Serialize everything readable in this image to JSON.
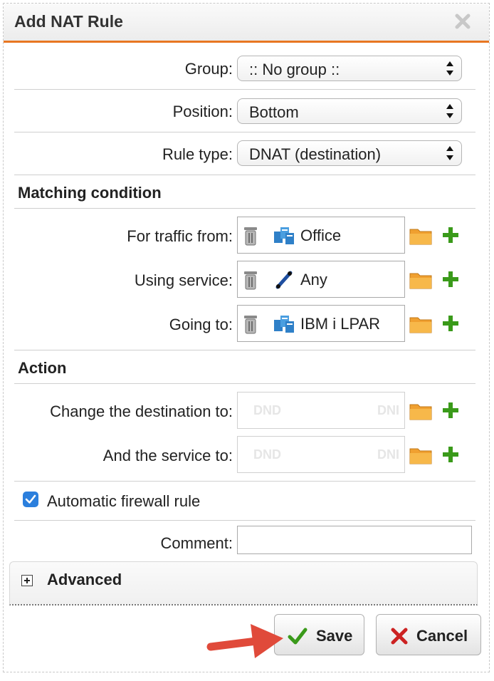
{
  "dialog": {
    "title": "Add NAT Rule"
  },
  "form": {
    "group": {
      "label": "Group:",
      "value": ":: No group ::"
    },
    "position": {
      "label": "Position:",
      "value": "Bottom"
    },
    "rule_type": {
      "label": "Rule type:",
      "value": "DNAT (destination)"
    }
  },
  "matching": {
    "heading": "Matching condition",
    "traffic_from": {
      "label": "For traffic from:",
      "value": "Office",
      "icon": "network-hosts-icon"
    },
    "service": {
      "label": "Using service:",
      "value": "Any",
      "icon": "service-any-icon"
    },
    "going_to": {
      "label": "Going to:",
      "value": "IBM i LPAR",
      "icon": "network-hosts-icon"
    }
  },
  "action": {
    "heading": "Action",
    "change_destination": {
      "label": "Change the destination to:",
      "ghost_left": "DND",
      "ghost_right": "DNI"
    },
    "service_to": {
      "label": "And the service to:",
      "ghost_left": "DND",
      "ghost_right": "DNI"
    }
  },
  "auto_firewall": {
    "label": "Automatic firewall rule",
    "checked": true
  },
  "comment": {
    "label": "Comment:",
    "value": ""
  },
  "advanced": {
    "label": "Advanced"
  },
  "buttons": {
    "save": "Save",
    "cancel": "Cancel"
  },
  "colors": {
    "accent": "#e87722",
    "checkbox": "#2b7fdd",
    "plus": "#3a9a1a",
    "save_check": "#3a9a1a",
    "cancel_x": "#cc2222",
    "folder": "#f0a030",
    "arrow": "#e04a3a"
  }
}
